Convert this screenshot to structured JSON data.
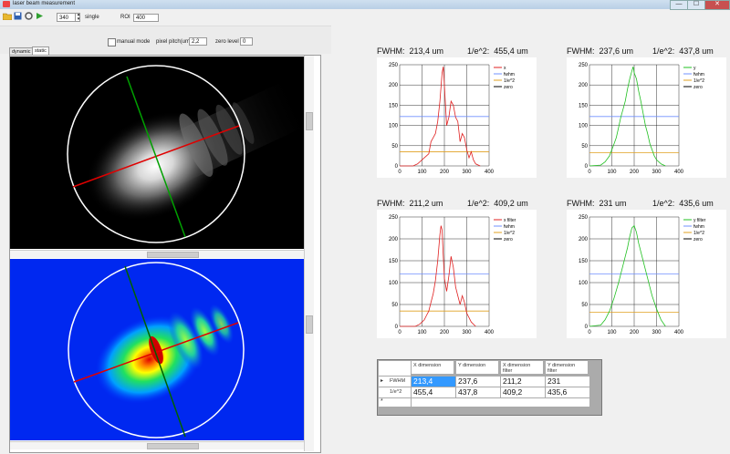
{
  "window": {
    "title": "laser beam measurement",
    "minimize": "—",
    "maximize": "☐",
    "close": "✕"
  },
  "toolbar": {
    "spin_value": "340",
    "single_label": "single",
    "roi_label": "ROI",
    "roi_value": "400",
    "icons": [
      "folder-icon",
      "save-icon",
      "settings-icon",
      "play-icon"
    ]
  },
  "options": {
    "manual_mode_label": "manual mode",
    "manual_mode_checked": false,
    "pixel_pitch_label": "pixel pitch(um)",
    "pixel_pitch_value": "2,2",
    "zero_level_label": "zero level",
    "zero_level_value": "0"
  },
  "tabs": [
    {
      "label": "dynamic"
    },
    {
      "label": "static"
    }
  ],
  "plots": [
    {
      "fwhm_label": "FWHM:",
      "fwhm_value": "213,4 um",
      "e2_label": "1/e^2:",
      "e2_value": "455,4 um",
      "color": "#e02020",
      "legend": [
        "x",
        "fwhm",
        "1/e^2",
        "zero"
      ]
    },
    {
      "fwhm_label": "FWHM:",
      "fwhm_value": "237,6 um",
      "e2_label": "1/e^2:",
      "e2_value": "437,8 um",
      "color": "#20c020",
      "legend": [
        "y",
        "fwhm",
        "1/e^2",
        "zero"
      ]
    },
    {
      "fwhm_label": "FWHM:",
      "fwhm_value": "211,2 um",
      "e2_label": "1/e^2:",
      "e2_value": "409,2 um",
      "color": "#e02020",
      "legend": [
        "x filter",
        "fwhm",
        "1/e^2",
        "zero"
      ]
    },
    {
      "fwhm_label": "FWHM:",
      "fwhm_value": "231 um",
      "e2_label": "1/e^2:",
      "e2_value": "435,6 um",
      "color": "#20c020",
      "legend": [
        "y filter",
        "fwhm",
        "1/e^2",
        "zero"
      ]
    }
  ],
  "legend_colors": {
    "fwhm": "#7090ff",
    "e2": "#e0a020",
    "zero": "#000000"
  },
  "axis": {
    "x_ticks": [
      "0",
      "100",
      "200",
      "300",
      "400"
    ],
    "y_ticks": [
      "0",
      "50",
      "100",
      "150",
      "200",
      "250"
    ]
  },
  "chart_data": [
    {
      "type": "line",
      "series": [
        {
          "name": "x",
          "color": "#e02020",
          "x": [
            0,
            60,
            80,
            100,
            110,
            120,
            130,
            140,
            150,
            160,
            170,
            180,
            190,
            195,
            200,
            205,
            210,
            220,
            230,
            240,
            250,
            260,
            270,
            280,
            290,
            300,
            310,
            320,
            330,
            340,
            360
          ],
          "y": [
            0,
            0,
            5,
            15,
            20,
            25,
            30,
            60,
            70,
            80,
            110,
            160,
            230,
            245,
            200,
            150,
            100,
            120,
            160,
            150,
            120,
            110,
            60,
            80,
            70,
            40,
            20,
            35,
            15,
            5,
            0
          ]
        }
      ],
      "lines": {
        "fwhm": 122,
        "e2": 35,
        "zero": 0
      },
      "xlim": [
        0,
        400
      ],
      "ylim": [
        0,
        250
      ]
    },
    {
      "type": "line",
      "series": [
        {
          "name": "y",
          "color": "#20c020",
          "x": [
            0,
            50,
            70,
            90,
            100,
            110,
            120,
            130,
            140,
            150,
            160,
            170,
            180,
            190,
            195,
            200,
            210,
            220,
            230,
            240,
            250,
            260,
            270,
            280,
            290,
            300,
            320,
            340
          ],
          "y": [
            0,
            2,
            10,
            25,
            40,
            55,
            70,
            95,
            120,
            140,
            160,
            190,
            215,
            235,
            245,
            230,
            215,
            185,
            160,
            130,
            100,
            80,
            55,
            40,
            25,
            15,
            5,
            0
          ]
        }
      ],
      "lines": {
        "fwhm": 122,
        "e2": 33,
        "zero": 0
      },
      "xlim": [
        0,
        400
      ],
      "ylim": [
        0,
        250
      ]
    },
    {
      "type": "line",
      "series": [
        {
          "name": "x filter",
          "color": "#e02020",
          "x": [
            0,
            70,
            90,
            110,
            120,
            130,
            140,
            150,
            160,
            170,
            180,
            185,
            190,
            195,
            200,
            210,
            220,
            230,
            240,
            250,
            260,
            270,
            280,
            290,
            300,
            310,
            320,
            340
          ],
          "y": [
            0,
            0,
            5,
            15,
            25,
            35,
            55,
            75,
            105,
            150,
            210,
            230,
            220,
            160,
            110,
            80,
            115,
            160,
            135,
            90,
            70,
            50,
            70,
            55,
            30,
            20,
            10,
            0
          ]
        }
      ],
      "lines": {
        "fwhm": 120,
        "e2": 35,
        "zero": 0
      },
      "xlim": [
        0,
        400
      ],
      "ylim": [
        0,
        250
      ]
    },
    {
      "type": "line",
      "series": [
        {
          "name": "y filter",
          "color": "#20c020",
          "x": [
            0,
            50,
            70,
            90,
            110,
            130,
            150,
            170,
            180,
            190,
            200,
            210,
            220,
            240,
            260,
            280,
            300,
            320,
            340
          ],
          "y": [
            0,
            3,
            15,
            35,
            65,
            100,
            140,
            180,
            205,
            225,
            230,
            215,
            190,
            150,
            110,
            70,
            40,
            15,
            0
          ]
        }
      ],
      "lines": {
        "fwhm": 120,
        "e2": 32,
        "zero": 0
      },
      "xlim": [
        0,
        400
      ],
      "ylim": [
        0,
        250
      ]
    }
  ],
  "table": {
    "headers": [
      "X dimension",
      "Y dimension",
      "X dimension filter",
      "Y dimension filter"
    ],
    "rows": [
      {
        "label": "FWHM",
        "values": [
          "213,4",
          "237,6",
          "211,2",
          "231"
        ]
      },
      {
        "label": "1/e^2",
        "values": [
          "455,4",
          "437,8",
          "409,2",
          "435,6"
        ]
      }
    ],
    "new_row_marker": "*",
    "current_row_marker": "▸"
  }
}
